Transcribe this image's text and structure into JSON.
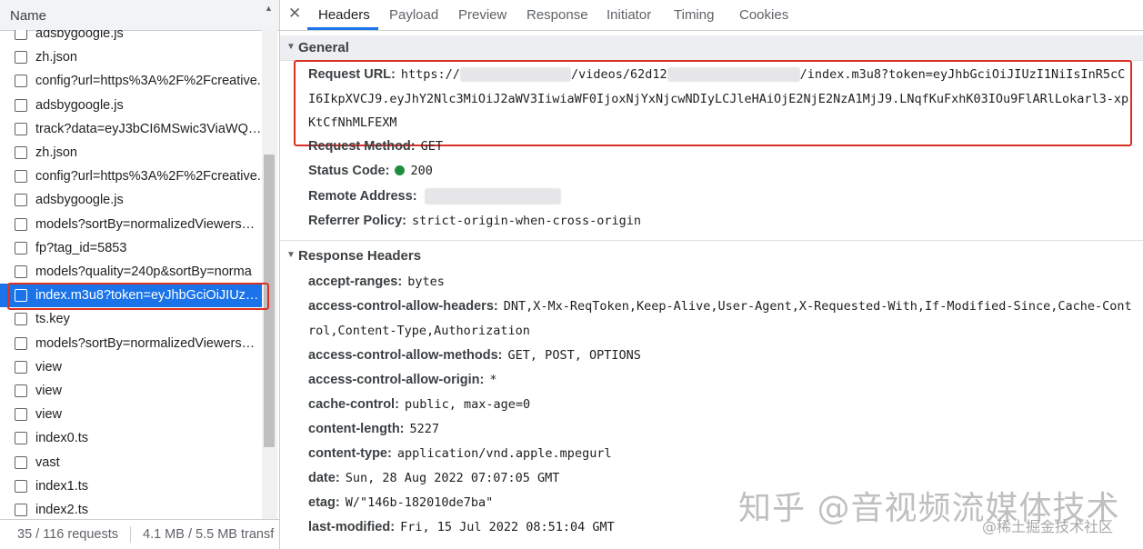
{
  "left": {
    "column_header": "Name",
    "requests": [
      "adsbygoogle.js",
      "zh.json",
      "config?url=https%3A%2F%2Fcreative.",
      "adsbygoogle.js",
      "track?data=eyJ3bCI6MSwic3ViaWQiO.",
      "zh.json",
      "config?url=https%3A%2F%2Fcreative.",
      "adsbygoogle.js",
      "models?sortBy=normalizedViewersRa.",
      "fp?tag_id=5853",
      "models?quality=240p&sortBy=norma",
      "index.m3u8?token=eyJhbGciOiJIUzI1..",
      "ts.key",
      "models?sortBy=normalizedViewersRa.",
      "view",
      "view",
      "view",
      "index0.ts",
      "vast",
      "index1.ts",
      "index2.ts"
    ],
    "selected_index": 11,
    "status_requests": "35 / 116 requests",
    "status_transfer": "4.1 MB / 5.5 MB transf"
  },
  "tabs": [
    "Headers",
    "Payload",
    "Preview",
    "Response",
    "Initiator",
    "Timing",
    "Cookies"
  ],
  "active_tab": "Headers",
  "general": {
    "title": "General",
    "request_url_label": "Request URL:",
    "request_url_part1": "https://",
    "request_url_part2": "/videos/62d12",
    "request_url_part3": "/index.m3u8?token=eyJhbGciOiJIUzI1NiIsInR5cC",
    "request_url_line2": "I6IkpXVCJ9.eyJhY2Nlc3MiOiJ2aWV3IiwiaWF0IjoxNjYxNjcwNDIyLCJleHAiOjE2NjE2NzA1MjJ9.LNqfKuFxhK03IOu9FlARlLokarl3-xp",
    "request_url_line3": "KtCfNhMLFEXM",
    "request_method_label": "Request Method:",
    "request_method": "GET",
    "status_code_label": "Status Code:",
    "status_code": "200",
    "remote_address_label": "Remote Address:",
    "referrer_policy_label": "Referrer Policy:",
    "referrer_policy": "strict-origin-when-cross-origin"
  },
  "response_headers": {
    "title": "Response Headers",
    "items": [
      {
        "k": "accept-ranges:",
        "v": "bytes"
      },
      {
        "k": "access-control-allow-headers:",
        "v": "DNT,X-Mx-ReqToken,Keep-Alive,User-Agent,X-Requested-With,If-Modified-Since,Cache-Cont",
        "cont": "rol,Content-Type,Authorization"
      },
      {
        "k": "access-control-allow-methods:",
        "v": "GET, POST, OPTIONS"
      },
      {
        "k": "access-control-allow-origin:",
        "v": "*"
      },
      {
        "k": "cache-control:",
        "v": "public, max-age=0"
      },
      {
        "k": "content-length:",
        "v": "5227"
      },
      {
        "k": "content-type:",
        "v": "application/vnd.apple.mpegurl"
      },
      {
        "k": "date:",
        "v": "Sun, 28 Aug 2022 07:07:05 GMT"
      },
      {
        "k": "etag:",
        "v": "W/\"146b-182010de7ba\""
      },
      {
        "k": "last-modified:",
        "v": "Fri, 15 Jul 2022 08:51:04 GMT"
      }
    ]
  },
  "watermark": "知乎 @音视频流媒体技术",
  "watermark2": "@稀土掘金技术社区",
  "colors": {
    "selected": "#1a73e8",
    "highlight": "#d93025",
    "status_ok": "#1e8e3e"
  }
}
